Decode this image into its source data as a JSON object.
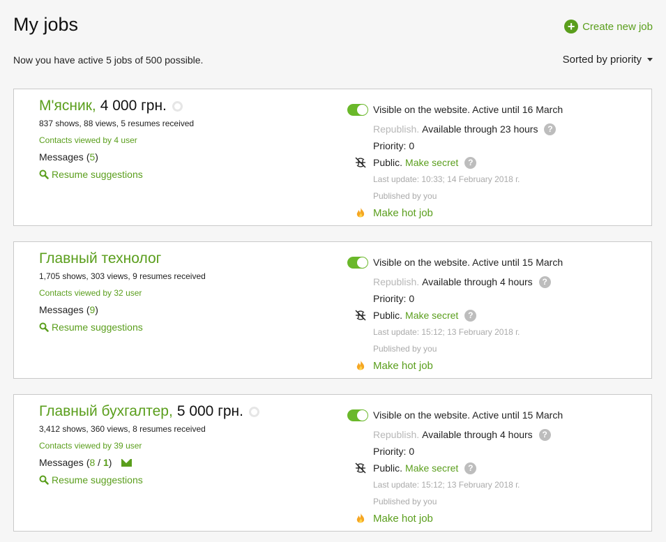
{
  "header": {
    "title": "My jobs",
    "create_label": "Create new job",
    "active_info": "Now you have active 5 jobs of 500 possible.",
    "sort_label": "Sorted by priority"
  },
  "jobs": [
    {
      "name": "М'ясник,",
      "salary": "4 000 грн.",
      "stats": "837 shows, 88 views, 5 resumes received",
      "contacts": "Contacts viewed by 4 user",
      "messages_label": "Messages",
      "messages_count": "5",
      "messages_new": "",
      "resume_label": "Resume suggestions",
      "visible_text": "Visible on the website. Active until 16 March",
      "republish": "Republish.",
      "available": "Available through 23 hours",
      "priority": "Priority: 0",
      "public": "Public.",
      "make_secret": "Make secret",
      "last_update": "Last update: 10:33; 14 February 2018 г.",
      "published_by": "Published by you",
      "hot_label": "Make hot job"
    },
    {
      "name": "Главный технолог",
      "salary": "",
      "stats": "1,705 shows, 303 views, 9 resumes received",
      "contacts": "Contacts viewed by 32 user",
      "messages_label": "Messages",
      "messages_count": "9",
      "messages_new": "",
      "resume_label": "Resume suggestions",
      "visible_text": "Visible on the website. Active until 15 March",
      "republish": "Republish.",
      "available": "Available through 4 hours",
      "priority": "Priority: 0",
      "public": "Public.",
      "make_secret": "Make secret",
      "last_update": "Last update: 15:12; 13 February 2018 г.",
      "published_by": "Published by you",
      "hot_label": "Make hot job"
    },
    {
      "name": "Главный бухгалтер,",
      "salary": "5 000 грн.",
      "stats": "3,412 shows, 360 views, 8 resumes received",
      "contacts": "Contacts viewed by 39 user",
      "messages_label": "Messages",
      "messages_count": "8",
      "messages_new": "1",
      "resume_label": "Resume suggestions",
      "visible_text": "Visible on the website. Active until 15 March",
      "republish": "Republish.",
      "available": "Available through 4 hours",
      "priority": "Priority: 0",
      "public": "Public.",
      "make_secret": "Make secret",
      "last_update": "Last update: 15:12; 13 February 2018 г.",
      "published_by": "Published by you",
      "hot_label": "Make hot job"
    }
  ],
  "colors": {
    "accent": "#5a9e1c",
    "toggle_on": "#6ab82a",
    "muted": "#aaaaaa"
  },
  "icons": [
    "plus-circle-icon",
    "caret-down-icon",
    "search-icon",
    "envelope-icon",
    "question-icon",
    "public-crossed-icon",
    "fire-icon"
  ]
}
